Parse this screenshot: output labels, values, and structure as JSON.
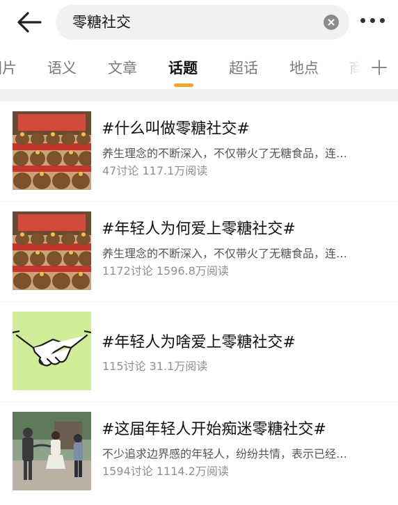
{
  "search": {
    "query": "零糖社交"
  },
  "tabs": [
    {
      "label": "图片",
      "active": false
    },
    {
      "label": "语义",
      "active": false
    },
    {
      "label": "文章",
      "active": false
    },
    {
      "label": "话题",
      "active": true
    },
    {
      "label": "超话",
      "active": false
    },
    {
      "label": "地点",
      "active": false
    },
    {
      "label": "商",
      "active": false
    }
  ],
  "colors": {
    "accent": "#f7a21b",
    "separator": "#f0f0f0",
    "meta_text": "#8f8f8f"
  },
  "icons": {
    "back": "arrow-left-icon",
    "clear": "clear-x-icon",
    "more": "more-dots-icon",
    "add_tab": "plus-icon"
  },
  "topics": [
    {
      "title": "#什么叫做零糖社交#",
      "description": "养生理念的不断深入，不仅带火了无糖食品，连…",
      "discussions": "47讨论",
      "reads": "117.1万阅读",
      "thumbnail": "capybara-plush-display"
    },
    {
      "title": "#年轻人为何爱上零糖社交#",
      "description": "养生理念的不断深入，不仅带火了无糖食品，连…",
      "discussions": "1172讨论",
      "reads": "1596.8万阅读",
      "thumbnail": "capybara-plush-display"
    },
    {
      "title": "#年轻人为啥爱上零糖社交#",
      "description": "",
      "discussions": "115讨论",
      "reads": "31.1万阅读",
      "thumbnail": "handshake-illustration"
    },
    {
      "title": "#这届年轻人开始痴迷零糖社交#",
      "description": "不少追求边界感的年轻人，纷纷共情，表示已经…",
      "discussions": "1594讨论",
      "reads": "1114.2万阅读",
      "thumbnail": "people-outdoor-photo"
    }
  ]
}
